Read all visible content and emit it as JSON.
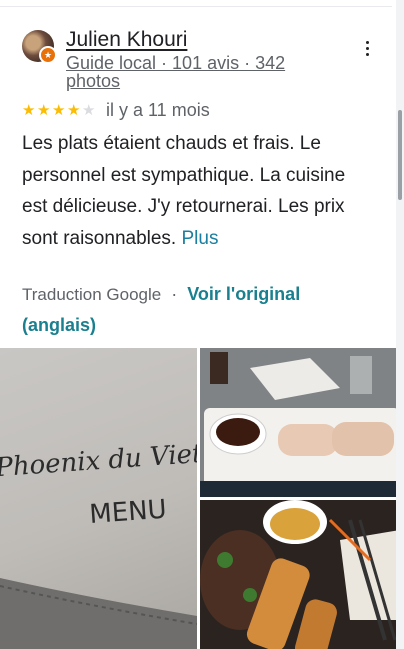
{
  "reviewer": {
    "name": "Julien Khouri",
    "meta": "Guide local · 101 avis · 342 photos"
  },
  "rating": {
    "stars": 4,
    "max": 5,
    "relative_time": "il y a 11 mois"
  },
  "review": {
    "text": "Les plats étaient chauds et frais. Le personnel est sympathique. La cuisine est délicieuse. J'y retournerai. Les prix sont raisonnables.",
    "more_label": "Plus"
  },
  "translation": {
    "provider": "Traduction Google",
    "separator": "·",
    "view_original": "Voir l'original (anglais)"
  },
  "photos": {
    "menu_sign": "Phoenix du Vietn",
    "menu_label": "MENU"
  },
  "colors": {
    "accent": "#1a7f8e",
    "star": "#fbbc04"
  }
}
